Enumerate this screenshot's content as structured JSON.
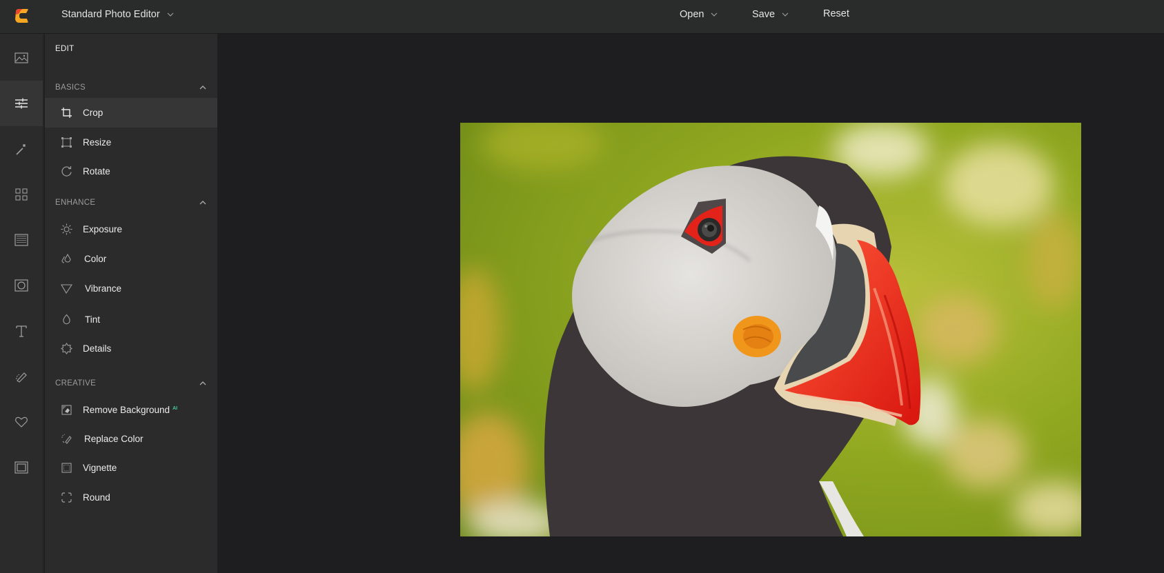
{
  "header": {
    "app_title": "Standard Photo Editor",
    "menu": [
      {
        "label": "Open",
        "has_dropdown": true
      },
      {
        "label": "Save",
        "has_dropdown": true
      },
      {
        "label": "Reset",
        "has_dropdown": false
      }
    ]
  },
  "rail": {
    "items": [
      {
        "name": "image",
        "icon": "image-icon",
        "active": false
      },
      {
        "name": "adjust",
        "icon": "sliders-icon",
        "active": true
      },
      {
        "name": "effects",
        "icon": "magic-wand-icon",
        "active": false
      },
      {
        "name": "layout",
        "icon": "grid-icon",
        "active": false
      },
      {
        "name": "texture",
        "icon": "texture-icon",
        "active": false
      },
      {
        "name": "frame",
        "icon": "frame-circle-icon",
        "active": false
      },
      {
        "name": "text",
        "icon": "text-icon",
        "active": false
      },
      {
        "name": "draw",
        "icon": "brush-icon",
        "active": false
      },
      {
        "name": "favorites",
        "icon": "heart-icon",
        "active": false
      },
      {
        "name": "border",
        "icon": "border-icon",
        "active": false
      }
    ]
  },
  "panel": {
    "title": "EDIT",
    "sections": [
      {
        "label": "BASICS",
        "expanded": true,
        "tools": [
          {
            "label": "Crop",
            "icon": "crop-icon",
            "active": true
          },
          {
            "label": "Resize",
            "icon": "resize-icon",
            "active": false
          },
          {
            "label": "Rotate",
            "icon": "rotate-icon",
            "active": false
          }
        ]
      },
      {
        "label": "ENHANCE",
        "expanded": true,
        "tools": [
          {
            "label": "Exposure",
            "icon": "sun-icon",
            "active": false
          },
          {
            "label": "Color",
            "icon": "drops-icon",
            "active": false
          },
          {
            "label": "Vibrance",
            "icon": "triangle-icon",
            "active": false
          },
          {
            "label": "Tint",
            "icon": "drop-icon",
            "active": false
          },
          {
            "label": "Details",
            "icon": "details-icon",
            "active": false
          }
        ]
      },
      {
        "label": "CREATIVE",
        "expanded": true,
        "tools": [
          {
            "label": "Remove Background",
            "icon": "remove-background-icon",
            "active": false,
            "badge": "AI"
          },
          {
            "label": "Replace Color",
            "icon": "replace-color-icon",
            "active": false
          },
          {
            "label": "Vignette",
            "icon": "vignette-icon",
            "active": false
          },
          {
            "label": "Round",
            "icon": "round-icon",
            "active": false
          }
        ]
      }
    ]
  },
  "canvas": {
    "photo_subject": "Atlantic puffin portrait"
  },
  "colors": {
    "accent_ai": "#3fcf9a",
    "logo_orange": "#f5a623",
    "logo_red": "#e8452b"
  }
}
